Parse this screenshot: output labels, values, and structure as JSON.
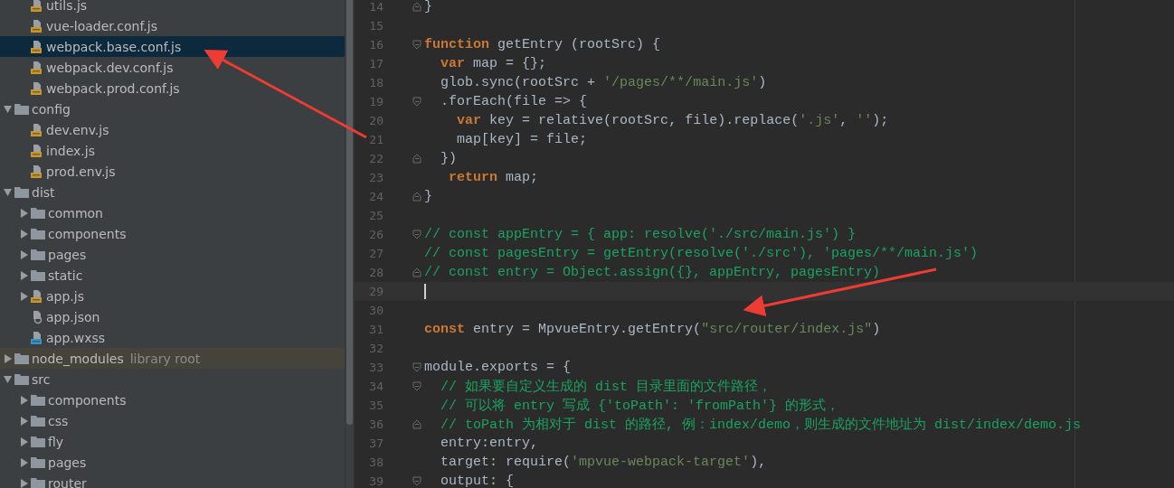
{
  "project_tree": {
    "continued_items": [
      {
        "name": "utils.js",
        "kind": "js",
        "selected": false
      },
      {
        "name": "vue-loader.conf.js",
        "kind": "js",
        "selected": false
      },
      {
        "name": "webpack.base.conf.js",
        "kind": "js",
        "selected": true
      },
      {
        "name": "webpack.dev.conf.js",
        "kind": "js",
        "selected": false
      },
      {
        "name": "webpack.prod.conf.js",
        "kind": "js",
        "selected": false
      }
    ],
    "items": [
      {
        "name": "config",
        "kind": "folder",
        "expanded": true,
        "selected": false,
        "children": [
          {
            "name": "dev.env.js",
            "kind": "js",
            "selected": false
          },
          {
            "name": "index.js",
            "kind": "js",
            "selected": false
          },
          {
            "name": "prod.env.js",
            "kind": "js",
            "selected": false
          }
        ]
      },
      {
        "name": "dist",
        "kind": "folder",
        "expanded": true,
        "selected": false,
        "children": [
          {
            "name": "common",
            "kind": "folder",
            "expanded": false,
            "selected": false
          },
          {
            "name": "components",
            "kind": "folder",
            "expanded": false,
            "selected": false
          },
          {
            "name": "pages",
            "kind": "folder",
            "expanded": false,
            "selected": false
          },
          {
            "name": "static",
            "kind": "folder",
            "expanded": false,
            "selected": false
          },
          {
            "name": "app.js",
            "kind": "js",
            "expanded": false,
            "selected": false
          },
          {
            "name": "app.json",
            "kind": "json",
            "selected": false
          },
          {
            "name": "app.wxss",
            "kind": "css",
            "selected": false
          }
        ]
      },
      {
        "name": "node_modules",
        "kind": "library",
        "note": "library root",
        "expanded": false,
        "selected": false
      },
      {
        "name": "src",
        "kind": "folder",
        "expanded": true,
        "selected": false,
        "children": [
          {
            "name": "components",
            "kind": "folder",
            "expanded": false,
            "selected": false
          },
          {
            "name": "css",
            "kind": "folder",
            "expanded": false,
            "selected": false
          },
          {
            "name": "fly",
            "kind": "folder",
            "expanded": false,
            "selected": false
          },
          {
            "name": "pages",
            "kind": "folder",
            "expanded": false,
            "selected": false
          },
          {
            "name": "router",
            "kind": "folder",
            "expanded": false,
            "selected": false
          }
        ]
      }
    ]
  },
  "editor": {
    "lines": [
      {
        "number": "14",
        "fold_start": false,
        "fold_end": true,
        "current": false,
        "text": "}"
      },
      {
        "number": "15",
        "fold_start": false,
        "fold_end": false,
        "current": false
      },
      {
        "number": "16",
        "fold_start": true,
        "fold_end": false,
        "current": false,
        "text": "function getEntry (rootSrc) {"
      },
      {
        "number": "17",
        "fold_start": false,
        "fold_end": false,
        "current": false,
        "text": "  var map = {};"
      },
      {
        "number": "18",
        "fold_start": false,
        "fold_end": false,
        "current": false,
        "text": "  glob.sync(rootSrc + '/pages/**/main.js')"
      },
      {
        "number": "19",
        "fold_start": true,
        "fold_end": false,
        "current": false,
        "text": "  .forEach(file => {"
      },
      {
        "number": "20",
        "fold_start": false,
        "fold_end": false,
        "current": false,
        "text": "    var key = relative(rootSrc, file).replace('.js', '');"
      },
      {
        "number": "21",
        "fold_start": false,
        "fold_end": false,
        "current": false,
        "text": "    map[key] = file;"
      },
      {
        "number": "22",
        "fold_start": false,
        "fold_end": true,
        "current": false,
        "text": "  })"
      },
      {
        "number": "23",
        "fold_start": false,
        "fold_end": false,
        "current": false,
        "text": "   return map;"
      },
      {
        "number": "24",
        "fold_start": false,
        "fold_end": true,
        "current": false,
        "text": "}"
      },
      {
        "number": "25",
        "fold_start": false,
        "fold_end": false,
        "current": false
      },
      {
        "number": "26",
        "fold_start": true,
        "fold_end": false,
        "current": false,
        "text": "// const appEntry = { app: resolve('./src/main.js') }"
      },
      {
        "number": "27",
        "fold_start": false,
        "fold_end": false,
        "current": false,
        "text": "// const pagesEntry = getEntry(resolve('./src'), 'pages/**/main.js')"
      },
      {
        "number": "28",
        "fold_start": false,
        "fold_end": true,
        "current": false,
        "text": "// const entry = Object.assign({}, appEntry, pagesEntry)"
      },
      {
        "number": "29",
        "fold_start": false,
        "fold_end": false,
        "current": true
      },
      {
        "number": "30",
        "fold_start": false,
        "fold_end": false,
        "current": false
      },
      {
        "number": "31",
        "fold_start": false,
        "fold_end": false,
        "current": false,
        "text": "const entry = MpvueEntry.getEntry(\"src/router/index.js\")"
      },
      {
        "number": "32",
        "fold_start": false,
        "fold_end": false,
        "current": false
      },
      {
        "number": "33",
        "fold_start": true,
        "fold_end": false,
        "current": false,
        "text": "module.exports = {"
      },
      {
        "number": "34",
        "fold_start": true,
        "fold_end": false,
        "current": false,
        "text": "  // 如果要自定义生成的 dist 目录里面的文件路径，"
      },
      {
        "number": "35",
        "fold_start": false,
        "fold_end": false,
        "current": false,
        "text": "  // 可以将 entry 写成 {'toPath': 'fromPath'} 的形式，"
      },
      {
        "number": "36",
        "fold_start": false,
        "fold_end": true,
        "current": false,
        "text": "  // toPath 为相对于 dist 的路径, 例：index/demo，则生成的文件地址为 dist/index/demo.js"
      },
      {
        "number": "37",
        "fold_start": false,
        "fold_end": false,
        "current": false,
        "text": "  entry:entry,"
      },
      {
        "number": "38",
        "fold_start": false,
        "fold_end": false,
        "current": false,
        "text": "  target: require('mpvue-webpack-target'),"
      },
      {
        "number": "39",
        "fold_start": true,
        "fold_end": false,
        "current": false,
        "text": "  output: {"
      }
    ]
  }
}
